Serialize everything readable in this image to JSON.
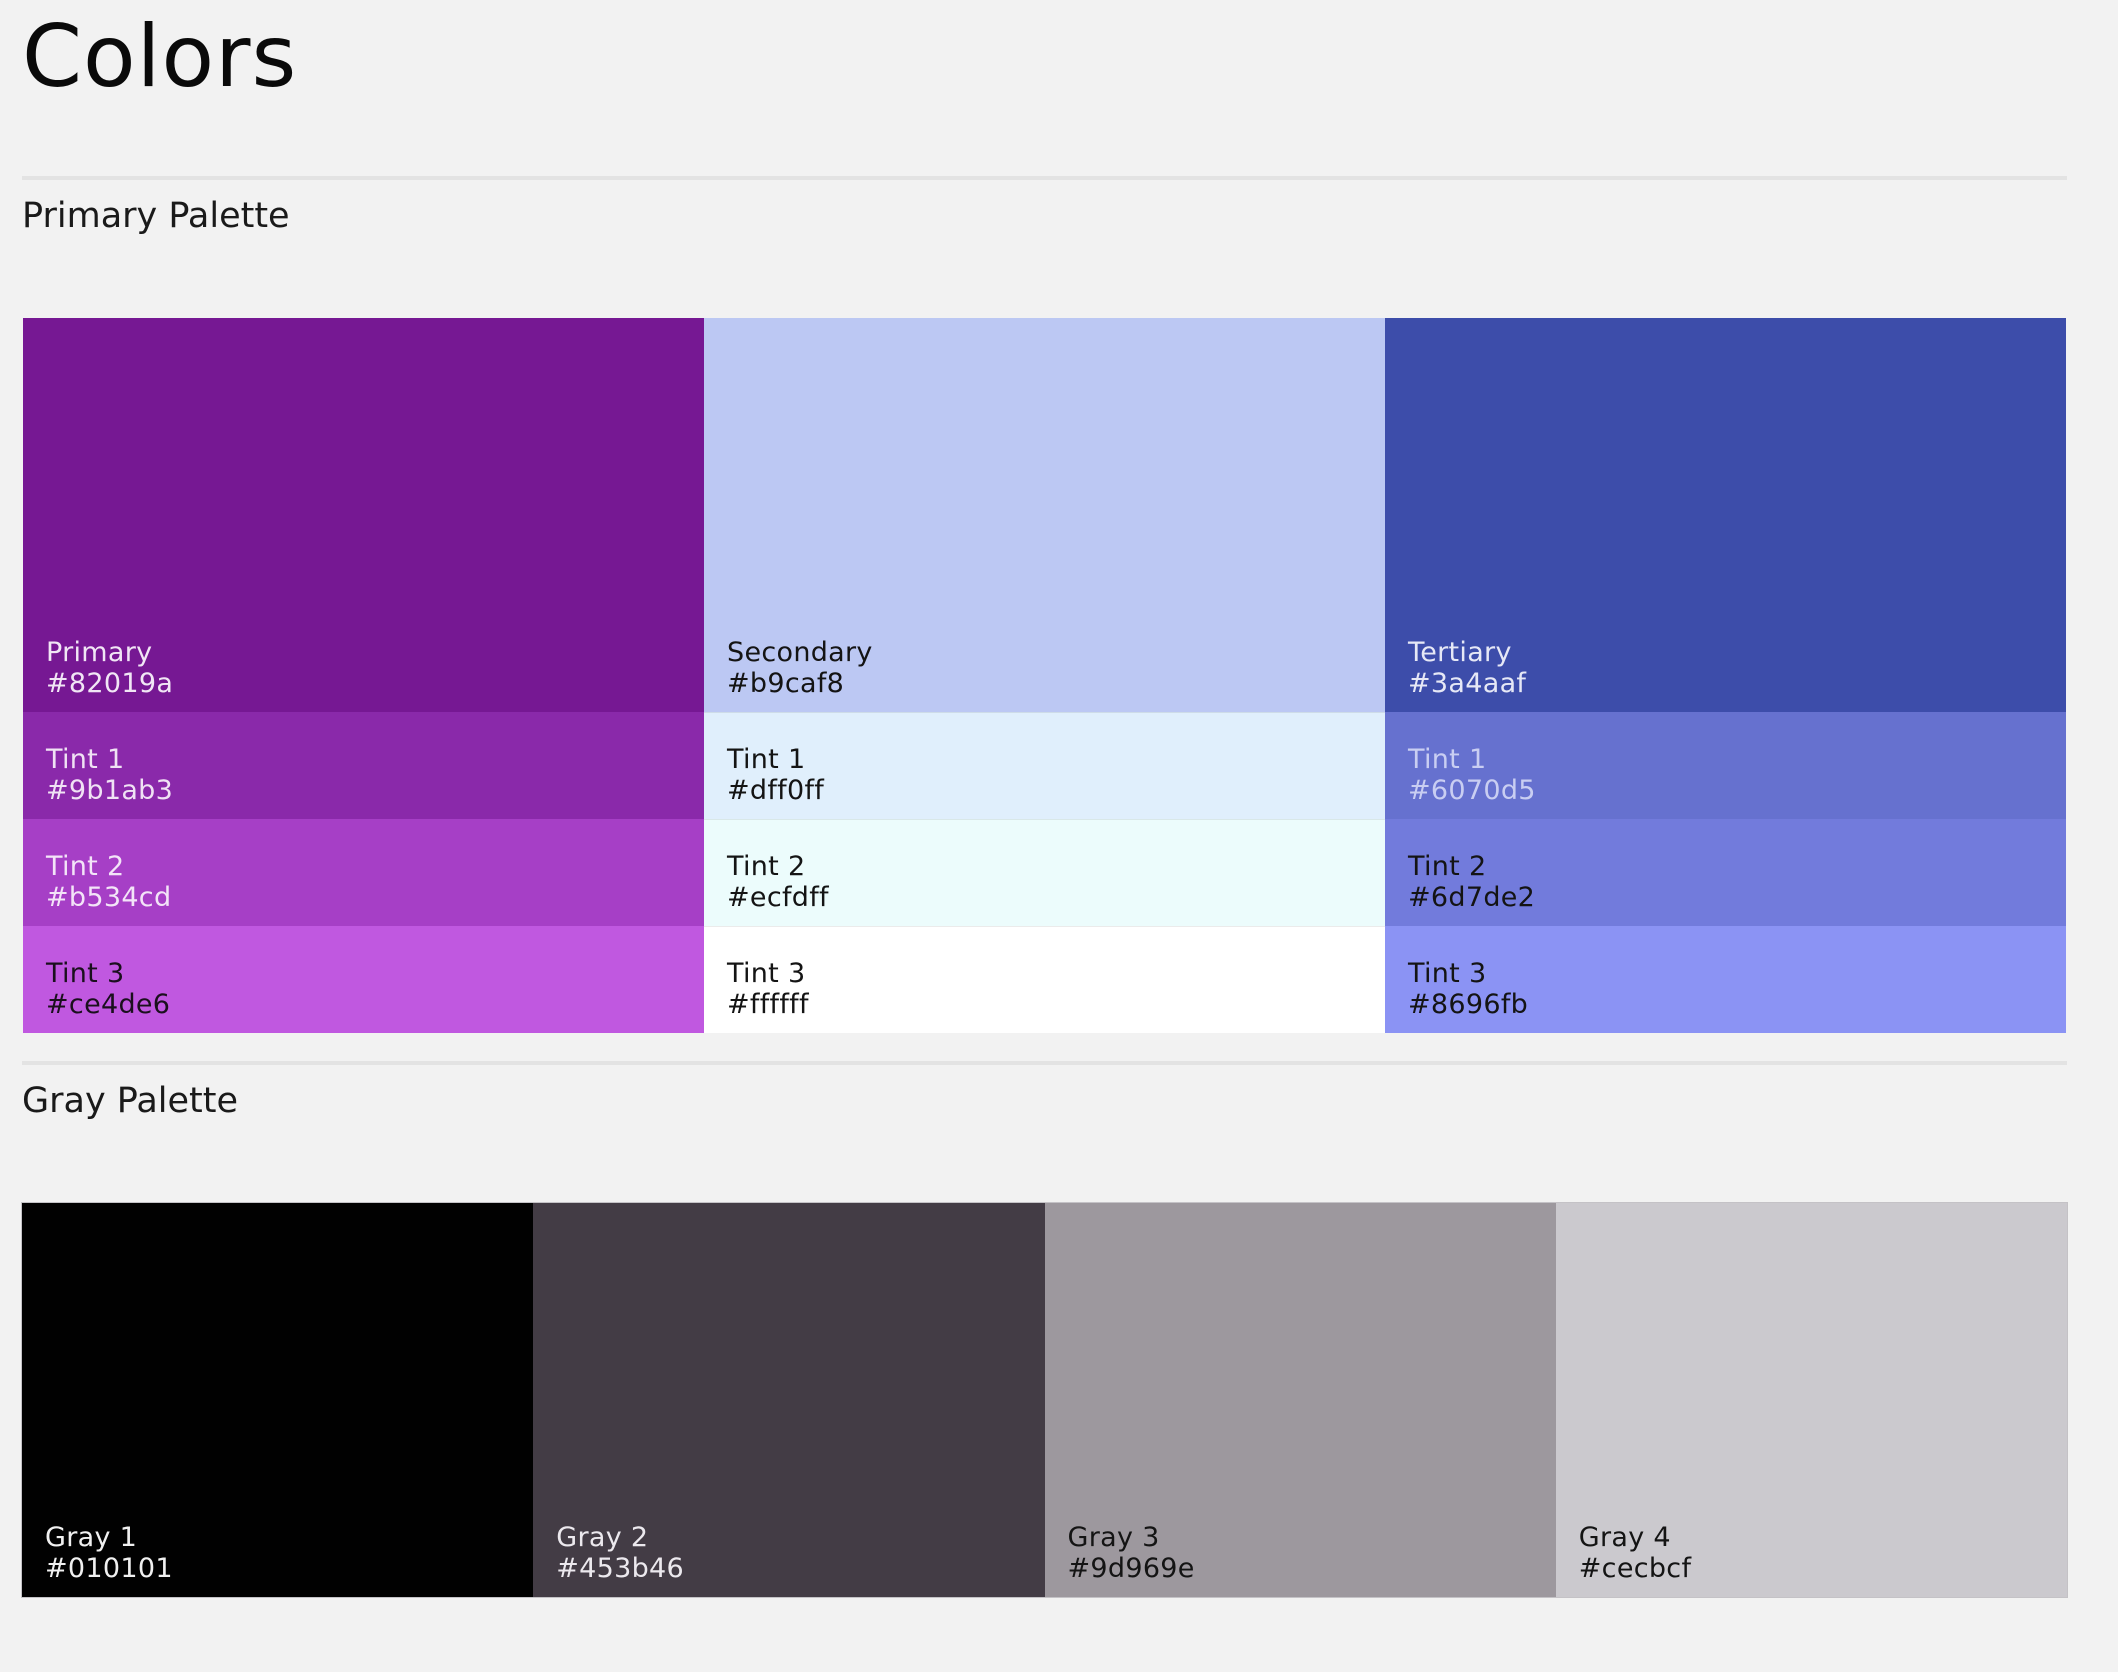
{
  "page": {
    "title": "Colors"
  },
  "primary_palette": {
    "heading": "Primary Palette",
    "columns": [
      {
        "main": {
          "name": "Primary",
          "hex": "#82019a",
          "fill": "#761893",
          "text": "#f1e6f5"
        },
        "tints": [
          {
            "name": "Tint 1",
            "hex": "#9b1ab3",
            "fill": "#8a29aa",
            "text": "#f0e2f4"
          },
          {
            "name": "Tint 2",
            "hex": "#b534cd",
            "fill": "#a63fc6",
            "text": "#f3e4f8"
          },
          {
            "name": "Tint 3",
            "hex": "#ce4de6",
            "fill": "#c058e0",
            "text": "#1a0f1d"
          }
        ]
      },
      {
        "main": {
          "name": "Secondary",
          "hex": "#b9caf8",
          "fill": "#bcc8f3",
          "text": "#141414"
        },
        "tints": [
          {
            "name": "Tint 1",
            "hex": "#dff0ff",
            "fill": "#e0effc",
            "text": "#141414"
          },
          {
            "name": "Tint 2",
            "hex": "#ecfdff",
            "fill": "#ecfcfc",
            "text": "#141414"
          },
          {
            "name": "Tint 3",
            "hex": "#ffffff",
            "fill": "#ffffff",
            "text": "#141414"
          }
        ]
      },
      {
        "main": {
          "name": "Tertiary",
          "hex": "#3a4aaf",
          "fill": "#3d4daa",
          "text": "#e6e8f6"
        },
        "tints": [
          {
            "name": "Tint 1",
            "hex": "#6070d5",
            "fill": "#6671cf",
            "text": "#c9cef2"
          },
          {
            "name": "Tint 2",
            "hex": "#6d7de2",
            "fill": "#727bdc",
            "text": "#141414"
          },
          {
            "name": "Tint 3",
            "hex": "#8696fb",
            "fill": "#8b93f4",
            "text": "#141414"
          }
        ]
      }
    ]
  },
  "gray_palette": {
    "heading": "Gray Palette",
    "swatches": [
      {
        "name": "Gray 1",
        "hex": "#010101",
        "fill": "#010101",
        "text": "#f0f0f0"
      },
      {
        "name": "Gray 2",
        "hex": "#453b46",
        "fill": "#433c45",
        "text": "#ece9ee"
      },
      {
        "name": "Gray 3",
        "hex": "#9d969e",
        "fill": "#9d989e",
        "text": "#141414"
      },
      {
        "name": "Gray 4",
        "hex": "#cecbcf",
        "fill": "#cbc9ce",
        "text": "#141414"
      }
    ]
  }
}
